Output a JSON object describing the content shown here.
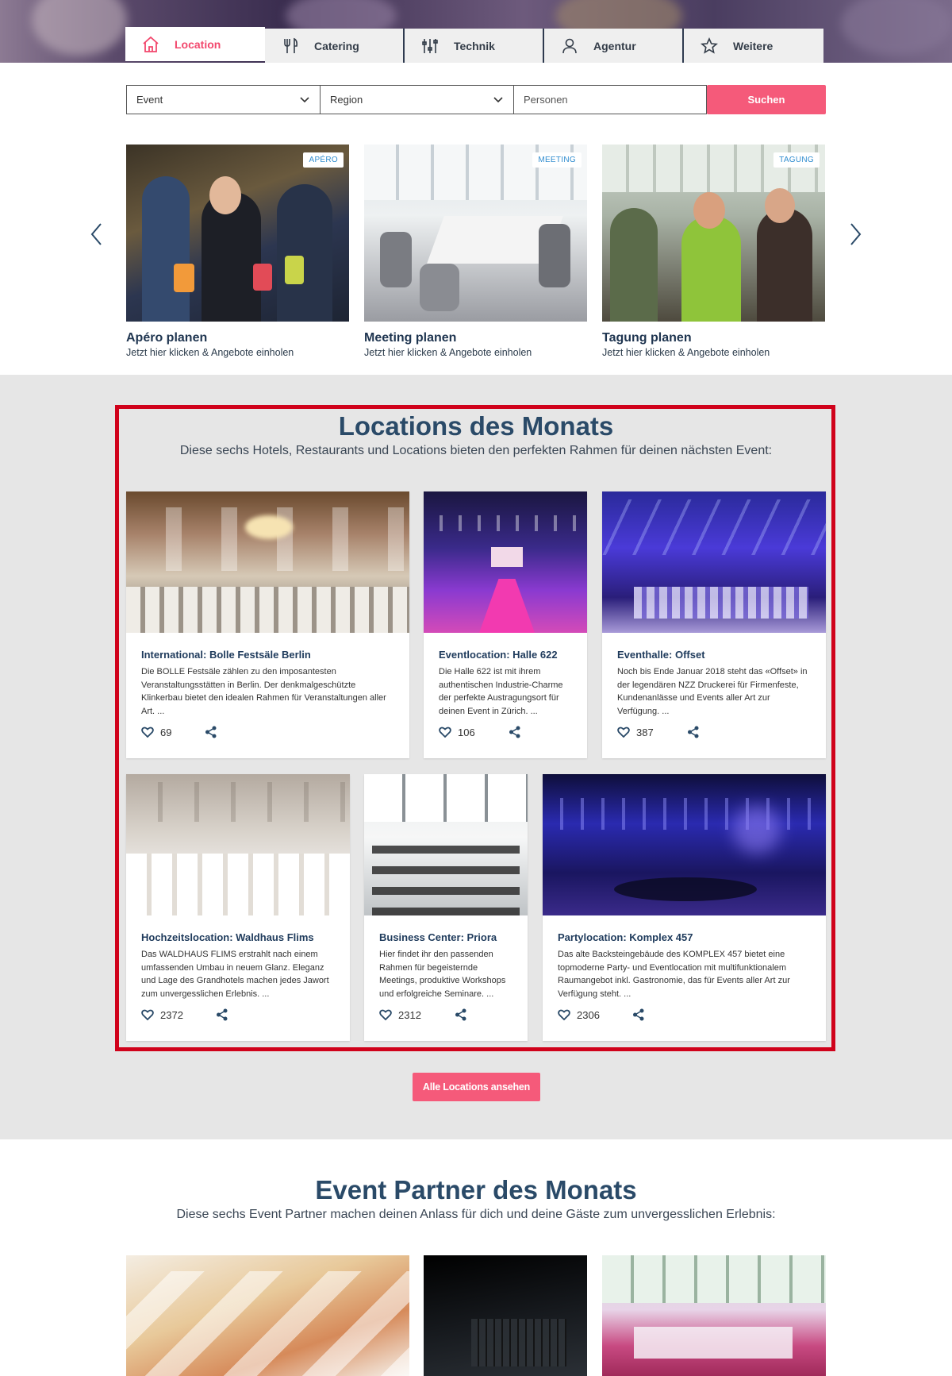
{
  "tabs": [
    {
      "label": "Location",
      "icon": "home-icon",
      "active": true
    },
    {
      "label": "Catering",
      "icon": "cutlery-icon",
      "active": false
    },
    {
      "label": "Technik",
      "icon": "sliders-icon",
      "active": false
    },
    {
      "label": "Agentur",
      "icon": "person-icon",
      "active": false
    },
    {
      "label": "Weitere",
      "icon": "star-icon",
      "active": false
    }
  ],
  "search": {
    "event": "Event",
    "region": "Region",
    "persons_placeholder": "Personen",
    "button": "Suchen"
  },
  "carousel": [
    {
      "badge": "APÉRO",
      "title": "Apéro planen",
      "subtitle": "Jetzt hier klicken & Angebote einholen"
    },
    {
      "badge": "MEETING",
      "title": "Meeting planen",
      "subtitle": "Jetzt hier klicken & Angebote einholen"
    },
    {
      "badge": "TAGUNG",
      "title": "Tagung planen",
      "subtitle": "Jetzt hier klicken & Angebote einholen"
    }
  ],
  "locations": {
    "title": "Locations des Monats",
    "subtitle": "Diese sechs Hotels, Restaurants und Locations bieten den perfekten Rahmen für deinen nächsten Event:",
    "cards": [
      {
        "title": "International: Bolle Festsäle Berlin",
        "desc": "Die BOLLE Festsäle zählen zu den imposantesten Veranstaltungsstätten in Berlin. Der denkmalgeschützte Klinkerbau bietet den idealen Rahmen für Veranstaltungen aller Art. ...",
        "likes": "69"
      },
      {
        "title": "Eventlocation: Halle 622",
        "desc": "Die Halle 622 ist mit ihrem authentischen Industrie-Charme der perfekte Austragungsort für deinen Event in Zürich. ...",
        "likes": "106"
      },
      {
        "title": "Eventhalle: Offset",
        "desc": "Noch bis Ende Januar 2018 steht das «Offset» in der legendären NZZ Druckerei für Firmenfeste, Kundenanlässe und Events aller Art zur Verfügung. ...",
        "likes": "387"
      },
      {
        "title": "Hochzeitslocation: Waldhaus Flims",
        "desc": "Das WALDHAUS FLIMS erstrahlt nach einem umfassenden Umbau in neuem Glanz. Eleganz und Lage des Grandhotels machen jedes Jawort zum unvergesslichen Erlebnis. ...",
        "likes": "2372"
      },
      {
        "title": "Business Center: Priora",
        "desc": "Hier findet ihr den passenden Rahmen für begeisternde Meetings, produktive Workshops und erfolgreiche Seminare. ...",
        "likes": "2312"
      },
      {
        "title": "Partylocation: Komplex 457",
        "desc": "Das alte Backsteingebäude des KOMPLEX 457 bietet eine topmoderne Party- und Eventlocation mit multifunktionalem Raumangebot inkl. Gastronomie, das für Events aller Art zur Verfügung steht. ...",
        "likes": "2306"
      }
    ],
    "cta": "Alle Locations ansehen"
  },
  "partners": {
    "title": "Event Partner des Monats",
    "subtitle": "Diese sechs Event Partner machen deinen Anlass für dich und deine Gäste zum unvergesslichen Erlebnis:"
  },
  "colors": {
    "accent": "#f55a7a",
    "navy": "#2a4a68",
    "frame": "#d0021b",
    "badge": "#2f8ccf"
  }
}
